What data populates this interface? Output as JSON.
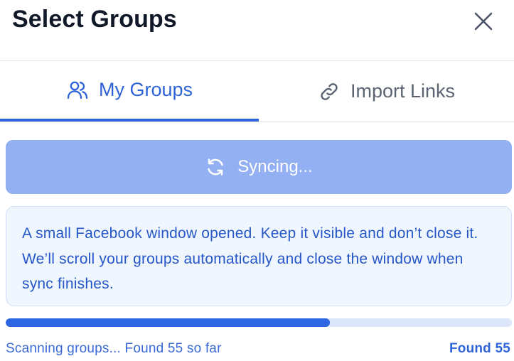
{
  "header": {
    "title": "Select Groups"
  },
  "tabs": [
    {
      "label": "My Groups",
      "icon": "users-icon",
      "active": true
    },
    {
      "label": "Import Links",
      "icon": "link-icon",
      "active": false
    }
  ],
  "sync": {
    "label": "Syncing...",
    "icon": "sync-icon"
  },
  "notice": {
    "text": "A small Facebook window opened. Keep it visible and don’t close it. We’ll scroll your groups automatically and close the window when sync finishes."
  },
  "progress": {
    "fraction": 0.641
  },
  "status": {
    "text": "Scanning groups... Found 55 so far",
    "found_label": "Found 55"
  },
  "colors": {
    "accent": "#2f64d8",
    "sync_button": "#93b0f3",
    "notice_bg": "#f0f6fe",
    "progress_fill": "#2c66e0",
    "progress_track": "#dbe6fb"
  }
}
